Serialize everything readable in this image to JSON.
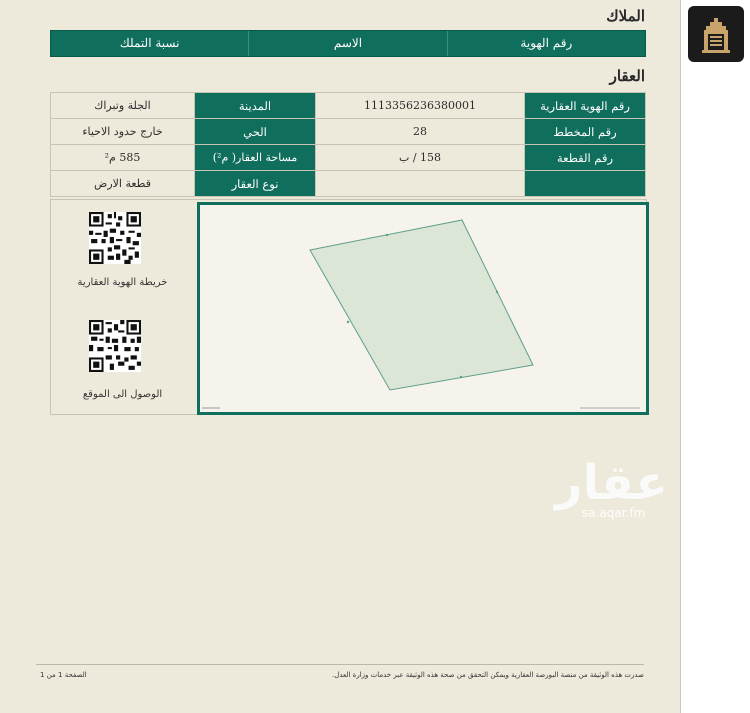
{
  "owners": {
    "title": "الملاك",
    "columns": [
      "رقم الهوية",
      "الاسم",
      "نسبة التملك"
    ]
  },
  "property": {
    "title": "العقار",
    "rows": [
      {
        "label1": "رقم الهوية العقارية",
        "value1": "1113356236380001",
        "label2": "المدينة",
        "value2": "الجلة وتبراك"
      },
      {
        "label1": "رقم المخطط",
        "value1": "28",
        "label2": "الحي",
        "value2": "خارج حدود الاحياء"
      },
      {
        "label1": "رقم القطعة",
        "value1": "158 / ب",
        "label2": "مساحة العقار( م²)",
        "value2": "585 م²"
      },
      {
        "label1": "",
        "value1": "",
        "label2": "نوع العقار",
        "value2": "قطعة الارض"
      }
    ]
  },
  "qr": {
    "map_label": "خريطة الهوية العقارية",
    "location_label": "الوصول الى الموقع"
  },
  "watermark": {
    "text": "عقار",
    "url": "sa.aqar.fm"
  },
  "footer": {
    "note": "صدرت هذه الوثيقة من منصة البورصة العقارية ويمكن التحقق من صحة هذه الوثيقة عبر خدمات وزارة العدل.",
    "page": "الصفحة 1 من 1"
  },
  "colors": {
    "accent": "#0f6e5c",
    "paper": "#eeeadb"
  },
  "icons": [
    "qr-code-icon",
    "app-logo-icon"
  ]
}
